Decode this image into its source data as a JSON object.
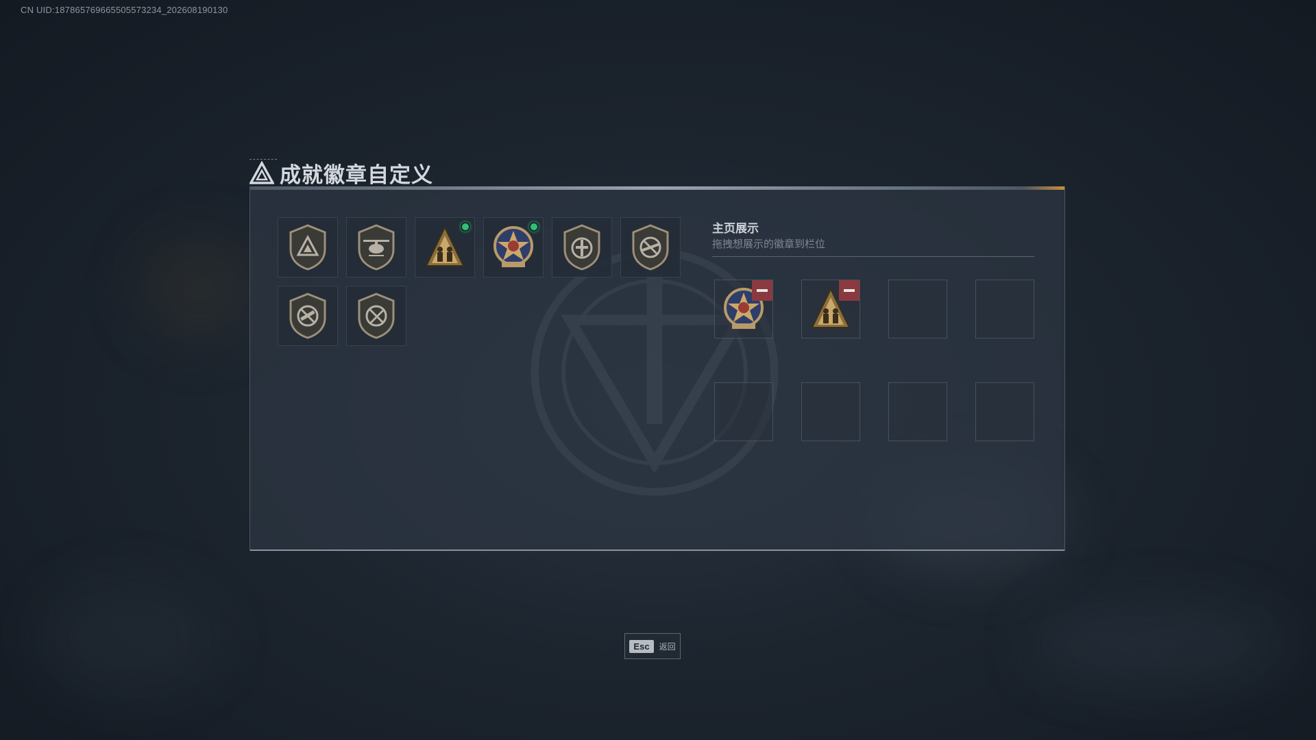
{
  "header": {
    "uid_text": "CN UID:1878657696655055732​34_202608190130"
  },
  "window": {
    "title": "成就徽章自定义"
  },
  "inventory": {
    "badges": [
      {
        "icon": "triangle-shield-badge-icon",
        "new": false
      },
      {
        "icon": "helicopter-shield-badge-icon",
        "new": false
      },
      {
        "icon": "soldiers-triangle-badge-icon",
        "new": true
      },
      {
        "icon": "star-medal-badge-icon",
        "new": true
      },
      {
        "icon": "knight-shield-badge-icon",
        "new": false
      },
      {
        "icon": "no-rifle-shield-badge-icon",
        "new": false
      },
      {
        "icon": "no-gun-shield-badge-icon",
        "new": false
      },
      {
        "icon": "no-knife-shield-badge-icon",
        "new": false
      }
    ]
  },
  "showcase": {
    "title": "主页展示",
    "subtitle": "拖拽想展示的徽章到栏位",
    "slots": [
      {
        "badge": "star-medal-badge-icon",
        "removable": true
      },
      {
        "badge": "soldiers-triangle-badge-icon",
        "removable": true
      },
      {
        "badge": null
      },
      {
        "badge": null
      },
      {
        "badge": null
      },
      {
        "badge": null
      },
      {
        "badge": null
      },
      {
        "badge": null
      }
    ]
  },
  "footer": {
    "esc_key": "Esc",
    "esc_label": "返回"
  },
  "colors": {
    "new_dot": "#2fbf7a",
    "remove_button": "#8a3a3e",
    "badge_gold": "#b89a6a"
  }
}
